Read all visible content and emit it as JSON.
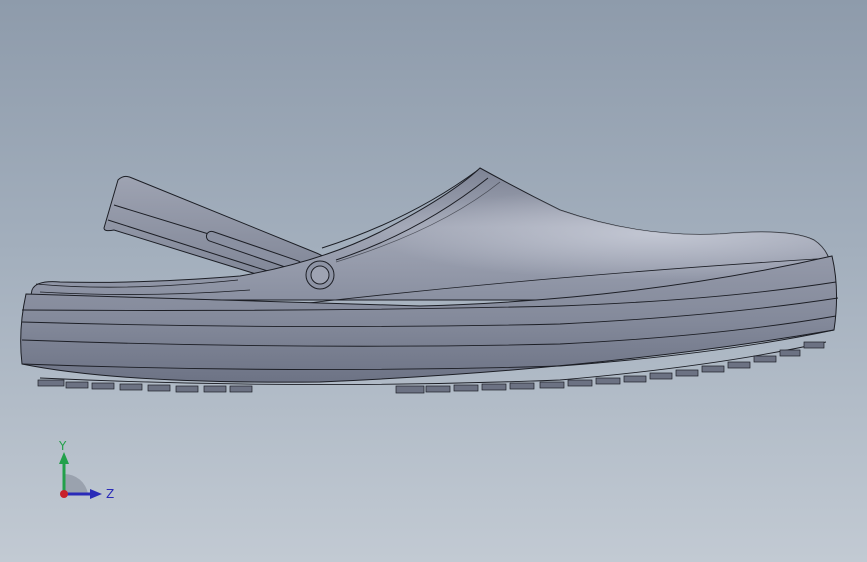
{
  "viewport": {
    "model": "clog-shoe",
    "view": "side",
    "colors": {
      "background_top": "#8e9bab",
      "background_bottom": "#c2cad3",
      "body": "#8d93a4",
      "edge": "#1c1e25",
      "highlight": "#c3c7d3",
      "shadow": "#5b6171"
    }
  },
  "triad": {
    "y_label": "Y",
    "z_label": "Z",
    "colors": {
      "y_axis": "#22a04a",
      "z_axis": "#2a2ab8",
      "x_axis": "#c8202a"
    }
  }
}
